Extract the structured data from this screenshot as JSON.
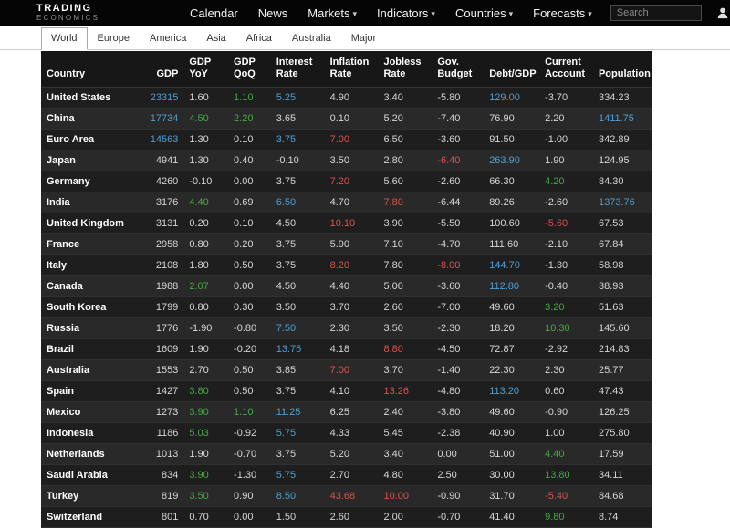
{
  "navbar": {
    "logo_line1": "TRADING",
    "logo_line2": "ECONOMICS",
    "items": [
      {
        "label": "Calendar",
        "caret": false
      },
      {
        "label": "News",
        "caret": false
      },
      {
        "label": "Markets",
        "caret": true
      },
      {
        "label": "Indicators",
        "caret": true
      },
      {
        "label": "Countries",
        "caret": true
      },
      {
        "label": "Forecasts",
        "caret": true
      }
    ],
    "search_placeholder": "Search",
    "icons": [
      "user-icon",
      "chevron-down-icon"
    ]
  },
  "tabs": {
    "items": [
      "World",
      "Europe",
      "America",
      "Asia",
      "Africa",
      "Australia",
      "Major"
    ],
    "active": "World"
  },
  "colors": {
    "blue": "#4e9fd4",
    "green": "#44a944",
    "red": "#d9534f"
  },
  "table": {
    "columns": [
      "Country",
      "GDP",
      "GDP\nYoY",
      "GDP\nQoQ",
      "Interest\nRate",
      "Inflation\nRate",
      "Jobless\nRate",
      "Gov.\nBudget",
      "Debt/GDP",
      "Current\nAccount",
      "Population"
    ],
    "rows": [
      {
        "country": "United States",
        "values": [
          [
            "23315",
            "blue"
          ],
          [
            "1.60",
            ""
          ],
          [
            "1.10",
            "green"
          ],
          [
            "5.25",
            "blue"
          ],
          [
            "4.90",
            ""
          ],
          [
            "3.40",
            ""
          ],
          [
            "-5.80",
            ""
          ],
          [
            "129.00",
            "blue"
          ],
          [
            "-3.70",
            ""
          ],
          [
            "334.23",
            ""
          ]
        ]
      },
      {
        "country": "China",
        "values": [
          [
            "17734",
            "blue"
          ],
          [
            "4.50",
            "green"
          ],
          [
            "2.20",
            "green"
          ],
          [
            "3.65",
            ""
          ],
          [
            "0.10",
            ""
          ],
          [
            "5.20",
            ""
          ],
          [
            "-7.40",
            ""
          ],
          [
            "76.90",
            ""
          ],
          [
            "2.20",
            ""
          ],
          [
            "1411.75",
            "blue"
          ]
        ]
      },
      {
        "country": "Euro Area",
        "values": [
          [
            "14563",
            "blue"
          ],
          [
            "1.30",
            ""
          ],
          [
            "0.10",
            ""
          ],
          [
            "3.75",
            "blue"
          ],
          [
            "7.00",
            "red"
          ],
          [
            "6.50",
            ""
          ],
          [
            "-3.60",
            ""
          ],
          [
            "91.50",
            ""
          ],
          [
            "-1.00",
            ""
          ],
          [
            "342.89",
            ""
          ]
        ]
      },
      {
        "country": "Japan",
        "values": [
          [
            "4941",
            ""
          ],
          [
            "1.30",
            ""
          ],
          [
            "0.40",
            ""
          ],
          [
            "-0.10",
            ""
          ],
          [
            "3.50",
            ""
          ],
          [
            "2.80",
            ""
          ],
          [
            "-6.40",
            "red"
          ],
          [
            "263.90",
            "blue"
          ],
          [
            "1.90",
            ""
          ],
          [
            "124.95",
            ""
          ]
        ]
      },
      {
        "country": "Germany",
        "values": [
          [
            "4260",
            ""
          ],
          [
            "-0.10",
            ""
          ],
          [
            "0.00",
            ""
          ],
          [
            "3.75",
            ""
          ],
          [
            "7.20",
            "red"
          ],
          [
            "5.60",
            ""
          ],
          [
            "-2.60",
            ""
          ],
          [
            "66.30",
            ""
          ],
          [
            "4.20",
            "green"
          ],
          [
            "84.30",
            ""
          ]
        ]
      },
      {
        "country": "India",
        "values": [
          [
            "3176",
            ""
          ],
          [
            "4.40",
            "green"
          ],
          [
            "0.69",
            ""
          ],
          [
            "6.50",
            "blue"
          ],
          [
            "4.70",
            ""
          ],
          [
            "7.80",
            "red"
          ],
          [
            "-6.44",
            ""
          ],
          [
            "89.26",
            ""
          ],
          [
            "-2.60",
            ""
          ],
          [
            "1373.76",
            "blue"
          ]
        ]
      },
      {
        "country": "United Kingdom",
        "values": [
          [
            "3131",
            ""
          ],
          [
            "0.20",
            ""
          ],
          [
            "0.10",
            ""
          ],
          [
            "4.50",
            ""
          ],
          [
            "10.10",
            "red"
          ],
          [
            "3.90",
            ""
          ],
          [
            "-5.50",
            ""
          ],
          [
            "100.60",
            ""
          ],
          [
            "-5.60",
            "red"
          ],
          [
            "67.53",
            ""
          ]
        ]
      },
      {
        "country": "France",
        "values": [
          [
            "2958",
            ""
          ],
          [
            "0.80",
            ""
          ],
          [
            "0.20",
            ""
          ],
          [
            "3.75",
            ""
          ],
          [
            "5.90",
            ""
          ],
          [
            "7.10",
            ""
          ],
          [
            "-4.70",
            ""
          ],
          [
            "111.60",
            ""
          ],
          [
            "-2.10",
            ""
          ],
          [
            "67.84",
            ""
          ]
        ]
      },
      {
        "country": "Italy",
        "values": [
          [
            "2108",
            ""
          ],
          [
            "1.80",
            ""
          ],
          [
            "0.50",
            ""
          ],
          [
            "3.75",
            ""
          ],
          [
            "8.20",
            "red"
          ],
          [
            "7.80",
            ""
          ],
          [
            "-8.00",
            "red"
          ],
          [
            "144.70",
            "blue"
          ],
          [
            "-1.30",
            ""
          ],
          [
            "58.98",
            ""
          ]
        ]
      },
      {
        "country": "Canada",
        "values": [
          [
            "1988",
            ""
          ],
          [
            "2.07",
            "green"
          ],
          [
            "0.00",
            ""
          ],
          [
            "4.50",
            ""
          ],
          [
            "4.40",
            ""
          ],
          [
            "5.00",
            ""
          ],
          [
            "-3.60",
            ""
          ],
          [
            "112.80",
            "blue"
          ],
          [
            "-0.40",
            ""
          ],
          [
            "38.93",
            ""
          ]
        ]
      },
      {
        "country": "South Korea",
        "values": [
          [
            "1799",
            ""
          ],
          [
            "0.80",
            ""
          ],
          [
            "0.30",
            ""
          ],
          [
            "3.50",
            ""
          ],
          [
            "3.70",
            ""
          ],
          [
            "2.60",
            ""
          ],
          [
            "-7.00",
            ""
          ],
          [
            "49.60",
            ""
          ],
          [
            "3.20",
            "green"
          ],
          [
            "51.63",
            ""
          ]
        ]
      },
      {
        "country": "Russia",
        "values": [
          [
            "1776",
            ""
          ],
          [
            "-1.90",
            ""
          ],
          [
            "-0.80",
            ""
          ],
          [
            "7.50",
            "blue"
          ],
          [
            "2.30",
            ""
          ],
          [
            "3.50",
            ""
          ],
          [
            "-2.30",
            ""
          ],
          [
            "18.20",
            ""
          ],
          [
            "10.30",
            "green"
          ],
          [
            "145.60",
            ""
          ]
        ]
      },
      {
        "country": "Brazil",
        "values": [
          [
            "1609",
            ""
          ],
          [
            "1.90",
            ""
          ],
          [
            "-0.20",
            ""
          ],
          [
            "13.75",
            "blue"
          ],
          [
            "4.18",
            ""
          ],
          [
            "8.80",
            "red"
          ],
          [
            "-4.50",
            ""
          ],
          [
            "72.87",
            ""
          ],
          [
            "-2.92",
            ""
          ],
          [
            "214.83",
            ""
          ]
        ]
      },
      {
        "country": "Australia",
        "values": [
          [
            "1553",
            ""
          ],
          [
            "2.70",
            ""
          ],
          [
            "0.50",
            ""
          ],
          [
            "3.85",
            ""
          ],
          [
            "7.00",
            "red"
          ],
          [
            "3.70",
            ""
          ],
          [
            "-1.40",
            ""
          ],
          [
            "22.30",
            ""
          ],
          [
            "2.30",
            ""
          ],
          [
            "25.77",
            ""
          ]
        ]
      },
      {
        "country": "Spain",
        "values": [
          [
            "1427",
            ""
          ],
          [
            "3.80",
            "green"
          ],
          [
            "0.50",
            ""
          ],
          [
            "3.75",
            ""
          ],
          [
            "4.10",
            ""
          ],
          [
            "13.26",
            "red"
          ],
          [
            "-4.80",
            ""
          ],
          [
            "113.20",
            "blue"
          ],
          [
            "0.60",
            ""
          ],
          [
            "47.43",
            ""
          ]
        ]
      },
      {
        "country": "Mexico",
        "values": [
          [
            "1273",
            ""
          ],
          [
            "3.90",
            "green"
          ],
          [
            "1.10",
            "green"
          ],
          [
            "11.25",
            "blue"
          ],
          [
            "6.25",
            ""
          ],
          [
            "2.40",
            ""
          ],
          [
            "-3.80",
            ""
          ],
          [
            "49.60",
            ""
          ],
          [
            "-0.90",
            ""
          ],
          [
            "126.25",
            ""
          ]
        ]
      },
      {
        "country": "Indonesia",
        "values": [
          [
            "1186",
            ""
          ],
          [
            "5.03",
            "green"
          ],
          [
            "-0.92",
            ""
          ],
          [
            "5.75",
            "blue"
          ],
          [
            "4.33",
            ""
          ],
          [
            "5.45",
            ""
          ],
          [
            "-2.38",
            ""
          ],
          [
            "40.90",
            ""
          ],
          [
            "1.00",
            ""
          ],
          [
            "275.80",
            ""
          ]
        ]
      },
      {
        "country": "Netherlands",
        "values": [
          [
            "1013",
            ""
          ],
          [
            "1.90",
            ""
          ],
          [
            "-0.70",
            ""
          ],
          [
            "3.75",
            ""
          ],
          [
            "5.20",
            ""
          ],
          [
            "3.40",
            ""
          ],
          [
            "0.00",
            ""
          ],
          [
            "51.00",
            ""
          ],
          [
            "4.40",
            "green"
          ],
          [
            "17.59",
            ""
          ]
        ]
      },
      {
        "country": "Saudi Arabia",
        "values": [
          [
            "834",
            ""
          ],
          [
            "3.90",
            "green"
          ],
          [
            "-1.30",
            ""
          ],
          [
            "5.75",
            "blue"
          ],
          [
            "2.70",
            ""
          ],
          [
            "4.80",
            ""
          ],
          [
            "2.50",
            ""
          ],
          [
            "30.00",
            ""
          ],
          [
            "13.80",
            "green"
          ],
          [
            "34.11",
            ""
          ]
        ]
      },
      {
        "country": "Turkey",
        "values": [
          [
            "819",
            ""
          ],
          [
            "3.50",
            "green"
          ],
          [
            "0.90",
            ""
          ],
          [
            "8.50",
            "blue"
          ],
          [
            "43.68",
            "red"
          ],
          [
            "10.00",
            "red"
          ],
          [
            "-0.90",
            ""
          ],
          [
            "31.70",
            ""
          ],
          [
            "-5.40",
            "red"
          ],
          [
            "84.68",
            ""
          ]
        ]
      },
      {
        "country": "Switzerland",
        "values": [
          [
            "801",
            ""
          ],
          [
            "0.70",
            ""
          ],
          [
            "0.00",
            ""
          ],
          [
            "1.50",
            ""
          ],
          [
            "2.60",
            ""
          ],
          [
            "2.00",
            ""
          ],
          [
            "-0.70",
            ""
          ],
          [
            "41.40",
            ""
          ],
          [
            "9.80",
            "green"
          ],
          [
            "8.74",
            ""
          ]
        ]
      }
    ]
  }
}
